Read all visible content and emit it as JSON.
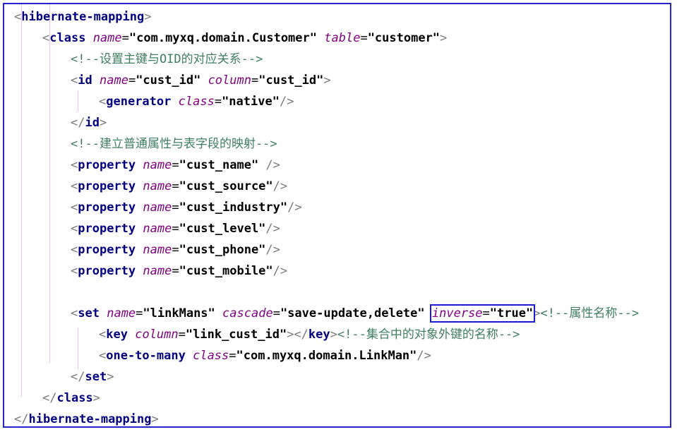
{
  "editor": {
    "lines": [
      [
        {
          "k": "b",
          "t": "<"
        },
        {
          "k": "t",
          "t": "hibernate-mapping"
        },
        {
          "k": "b",
          "t": ">"
        }
      ],
      [
        {
          "k": "b",
          "t": "<"
        },
        {
          "k": "t",
          "t": "class"
        },
        {
          "k": "e",
          "t": " "
        },
        {
          "k": "a",
          "t": "name"
        },
        {
          "k": "e",
          "t": "="
        },
        {
          "k": "v",
          "t": "\"com.myxq.domain.Customer\""
        },
        {
          "k": "e",
          "t": " "
        },
        {
          "k": "a",
          "t": "table"
        },
        {
          "k": "e",
          "t": "="
        },
        {
          "k": "v",
          "t": "\"customer\""
        },
        {
          "k": "b",
          "t": ">"
        }
      ],
      [
        {
          "k": "c",
          "t": "<!--设置主键与OID的对应关系-->"
        }
      ],
      [
        {
          "k": "b",
          "t": "<"
        },
        {
          "k": "t",
          "t": "id"
        },
        {
          "k": "e",
          "t": " "
        },
        {
          "k": "a",
          "t": "name"
        },
        {
          "k": "e",
          "t": "="
        },
        {
          "k": "v",
          "t": "\"cust_id\""
        },
        {
          "k": "e",
          "t": " "
        },
        {
          "k": "a",
          "t": "column"
        },
        {
          "k": "e",
          "t": "="
        },
        {
          "k": "v",
          "t": "\"cust_id\""
        },
        {
          "k": "b",
          "t": ">"
        }
      ],
      [
        {
          "k": "b",
          "t": "<"
        },
        {
          "k": "t",
          "t": "generator"
        },
        {
          "k": "e",
          "t": " "
        },
        {
          "k": "a",
          "t": "class"
        },
        {
          "k": "e",
          "t": "="
        },
        {
          "k": "v",
          "t": "\"native\""
        },
        {
          "k": "b",
          "t": "/>"
        }
      ],
      [
        {
          "k": "b",
          "t": "</"
        },
        {
          "k": "t",
          "t": "id"
        },
        {
          "k": "b",
          "t": ">"
        }
      ],
      [
        {
          "k": "c",
          "t": "<!--建立普通属性与表字段的映射-->"
        }
      ],
      [
        {
          "k": "b",
          "t": "<"
        },
        {
          "k": "t",
          "t": "property"
        },
        {
          "k": "e",
          "t": " "
        },
        {
          "k": "a",
          "t": "name"
        },
        {
          "k": "e",
          "t": "="
        },
        {
          "k": "v",
          "t": "\"cust_name\""
        },
        {
          "k": "e",
          "t": " "
        },
        {
          "k": "b",
          "t": "/>"
        }
      ],
      [
        {
          "k": "b",
          "t": "<"
        },
        {
          "k": "t",
          "t": "property"
        },
        {
          "k": "e",
          "t": " "
        },
        {
          "k": "a",
          "t": "name"
        },
        {
          "k": "e",
          "t": "="
        },
        {
          "k": "v",
          "t": "\"cust_source\""
        },
        {
          "k": "b",
          "t": "/>"
        }
      ],
      [
        {
          "k": "b",
          "t": "<"
        },
        {
          "k": "t",
          "t": "property"
        },
        {
          "k": "e",
          "t": " "
        },
        {
          "k": "a",
          "t": "name"
        },
        {
          "k": "e",
          "t": "="
        },
        {
          "k": "v",
          "t": "\"cust_industry\""
        },
        {
          "k": "b",
          "t": "/>"
        }
      ],
      [
        {
          "k": "b",
          "t": "<"
        },
        {
          "k": "t",
          "t": "property"
        },
        {
          "k": "e",
          "t": " "
        },
        {
          "k": "a",
          "t": "name"
        },
        {
          "k": "e",
          "t": "="
        },
        {
          "k": "v",
          "t": "\"cust_level\""
        },
        {
          "k": "b",
          "t": "/>"
        }
      ],
      [
        {
          "k": "b",
          "t": "<"
        },
        {
          "k": "t",
          "t": "property"
        },
        {
          "k": "e",
          "t": " "
        },
        {
          "k": "a",
          "t": "name"
        },
        {
          "k": "e",
          "t": "="
        },
        {
          "k": "v",
          "t": "\"cust_phone\""
        },
        {
          "k": "b",
          "t": "/>"
        }
      ],
      [
        {
          "k": "b",
          "t": "<"
        },
        {
          "k": "t",
          "t": "property"
        },
        {
          "k": "e",
          "t": " "
        },
        {
          "k": "a",
          "t": "name"
        },
        {
          "k": "e",
          "t": "="
        },
        {
          "k": "v",
          "t": "\"cust_mobile\""
        },
        {
          "k": "b",
          "t": "/>"
        }
      ],
      [],
      [
        {
          "k": "b",
          "t": "<"
        },
        {
          "k": "t",
          "t": "set"
        },
        {
          "k": "e",
          "t": " "
        },
        {
          "k": "a",
          "t": "name"
        },
        {
          "k": "e",
          "t": "="
        },
        {
          "k": "v",
          "t": "\"linkMans\""
        },
        {
          "k": "e",
          "t": " "
        },
        {
          "k": "a",
          "t": "cascade"
        },
        {
          "k": "e",
          "t": "="
        },
        {
          "k": "v",
          "t": "\"save-update,delete\""
        },
        {
          "k": "e",
          "t": " "
        },
        {
          "k": "a",
          "t": "inverse",
          "hl": true
        },
        {
          "k": "e",
          "t": "=",
          "hl": true
        },
        {
          "k": "v",
          "t": "\"true\"",
          "hl": true
        },
        {
          "k": "b",
          "t": ">"
        },
        {
          "k": "c",
          "t": "<!--属性名称-->"
        }
      ],
      [
        {
          "k": "b",
          "t": "<"
        },
        {
          "k": "t",
          "t": "key"
        },
        {
          "k": "e",
          "t": " "
        },
        {
          "k": "a",
          "t": "column"
        },
        {
          "k": "e",
          "t": "="
        },
        {
          "k": "v",
          "t": "\"link_cust_id\""
        },
        {
          "k": "b",
          "t": "></"
        },
        {
          "k": "t",
          "t": "key"
        },
        {
          "k": "b",
          "t": ">"
        },
        {
          "k": "c",
          "t": "<!--集合中的对象外键的名称-->"
        }
      ],
      [
        {
          "k": "b",
          "t": "<"
        },
        {
          "k": "t",
          "t": "one-to-many"
        },
        {
          "k": "e",
          "t": " "
        },
        {
          "k": "a",
          "t": "class"
        },
        {
          "k": "e",
          "t": "="
        },
        {
          "k": "v",
          "t": "\"com.myxq.domain.LinkMan\""
        },
        {
          "k": "b",
          "t": "/>"
        }
      ],
      [
        {
          "k": "b",
          "t": "</"
        },
        {
          "k": "t",
          "t": "set"
        },
        {
          "k": "b",
          "t": ">"
        }
      ],
      [
        {
          "k": "b",
          "t": "</"
        },
        {
          "k": "t",
          "t": "class"
        },
        {
          "k": "b",
          "t": ">"
        }
      ],
      [
        {
          "k": "b",
          "t": "</"
        },
        {
          "k": "t",
          "t": "hibernate-mapping"
        },
        {
          "k": "b",
          "t": ">"
        }
      ]
    ]
  }
}
